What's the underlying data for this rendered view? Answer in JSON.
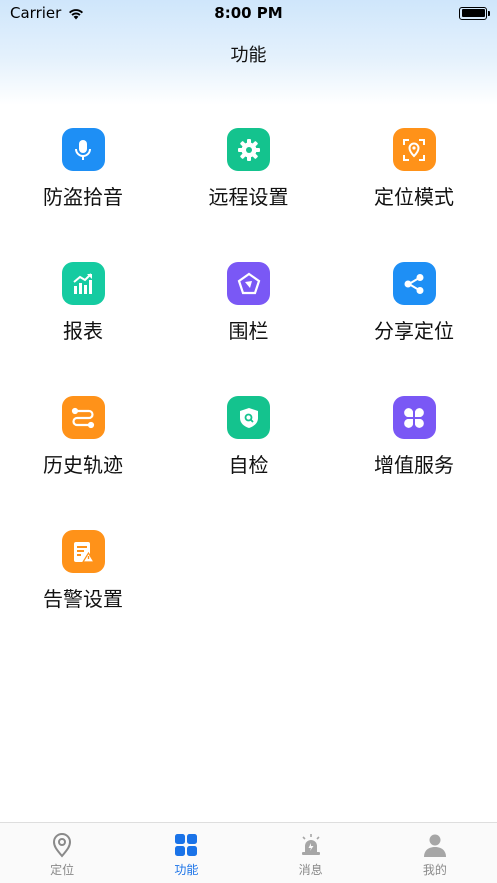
{
  "status_bar": {
    "carrier": "Carrier",
    "time": "8:00 PM"
  },
  "nav": {
    "title": "功能"
  },
  "features": [
    {
      "label": "防盗拾音",
      "icon": "microphone-icon",
      "color": "#1e8ff5"
    },
    {
      "label": "远程设置",
      "icon": "gear-icon",
      "color": "#14c38e"
    },
    {
      "label": "定位模式",
      "icon": "location-scan-icon",
      "color": "#ff9219"
    },
    {
      "label": "报表",
      "icon": "chart-icon",
      "color": "#15cba1"
    },
    {
      "label": "围栏",
      "icon": "fence-icon",
      "color": "#7a58f5"
    },
    {
      "label": "分享定位",
      "icon": "share-icon",
      "color": "#1e8ff5"
    },
    {
      "label": "历史轨迹",
      "icon": "track-icon",
      "color": "#ff9219"
    },
    {
      "label": "自检",
      "icon": "shield-search-icon",
      "color": "#14c38e"
    },
    {
      "label": "增值服务",
      "icon": "clover-icon",
      "color": "#7a58f5"
    },
    {
      "label": "告警设置",
      "icon": "alarm-document-icon",
      "color": "#ff9219"
    }
  ],
  "tabbar": {
    "tabs": [
      {
        "label": "定位",
        "icon": "location-pin-icon"
      },
      {
        "label": "功能",
        "icon": "grid-icon"
      },
      {
        "label": "消息",
        "icon": "siren-icon"
      },
      {
        "label": "我的",
        "icon": "person-icon"
      }
    ],
    "active_color": "#1a73e8",
    "inactive_color": "#8a8a8a"
  }
}
